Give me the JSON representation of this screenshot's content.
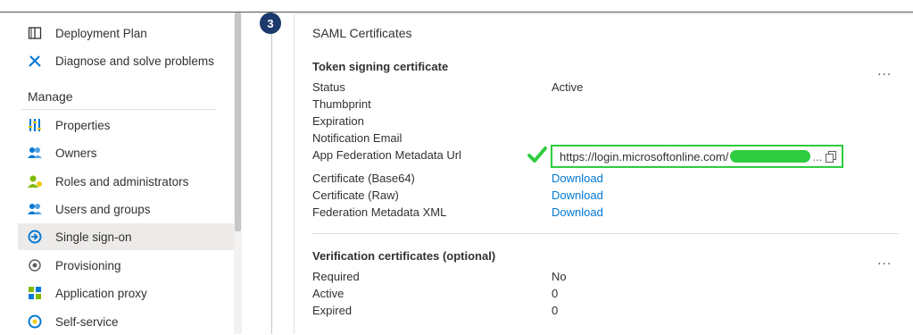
{
  "sidebar": {
    "items_top": [
      {
        "label": "Deployment Plan",
        "icon": "book-icon"
      },
      {
        "label": "Diagnose and solve problems",
        "icon": "wrench-icon"
      }
    ],
    "manage_header": "Manage",
    "items": [
      {
        "label": "Properties",
        "icon": "properties-icon"
      },
      {
        "label": "Owners",
        "icon": "owners-icon"
      },
      {
        "label": "Roles and administrators",
        "icon": "roles-icon"
      },
      {
        "label": "Users and groups",
        "icon": "users-groups-icon"
      },
      {
        "label": "Single sign-on",
        "icon": "sso-icon",
        "selected": true
      },
      {
        "label": "Provisioning",
        "icon": "provisioning-icon"
      },
      {
        "label": "Application proxy",
        "icon": "app-proxy-icon"
      },
      {
        "label": "Self-service",
        "icon": "self-service-icon"
      }
    ]
  },
  "step": {
    "number": "3"
  },
  "card": {
    "title": "SAML Certificates",
    "token_section": {
      "heading": "Token signing certificate",
      "rows": [
        {
          "key": "Status",
          "value": "Active"
        },
        {
          "key": "Thumbprint",
          "value": ""
        },
        {
          "key": "Expiration",
          "value": ""
        },
        {
          "key": "Notification Email",
          "value": ""
        },
        {
          "key": "App Federation Metadata Url",
          "value": "https://login.microsoftonline.com/"
        },
        {
          "key": "Certificate (Base64)",
          "value": "Download"
        },
        {
          "key": "Certificate (Raw)",
          "value": "Download"
        },
        {
          "key": "Federation Metadata XML",
          "value": "Download"
        }
      ],
      "url_truncation": "..."
    },
    "verification_section": {
      "heading": "Verification certificates (optional)",
      "rows": [
        {
          "key": "Required",
          "value": "No"
        },
        {
          "key": "Active",
          "value": "0"
        },
        {
          "key": "Expired",
          "value": "0"
        }
      ]
    },
    "more_label": "..."
  },
  "colors": {
    "accent": "#0078d4",
    "highlight": "#2ecc40",
    "badge": "#1b3a6b",
    "selected_bg": "#edebe9"
  }
}
